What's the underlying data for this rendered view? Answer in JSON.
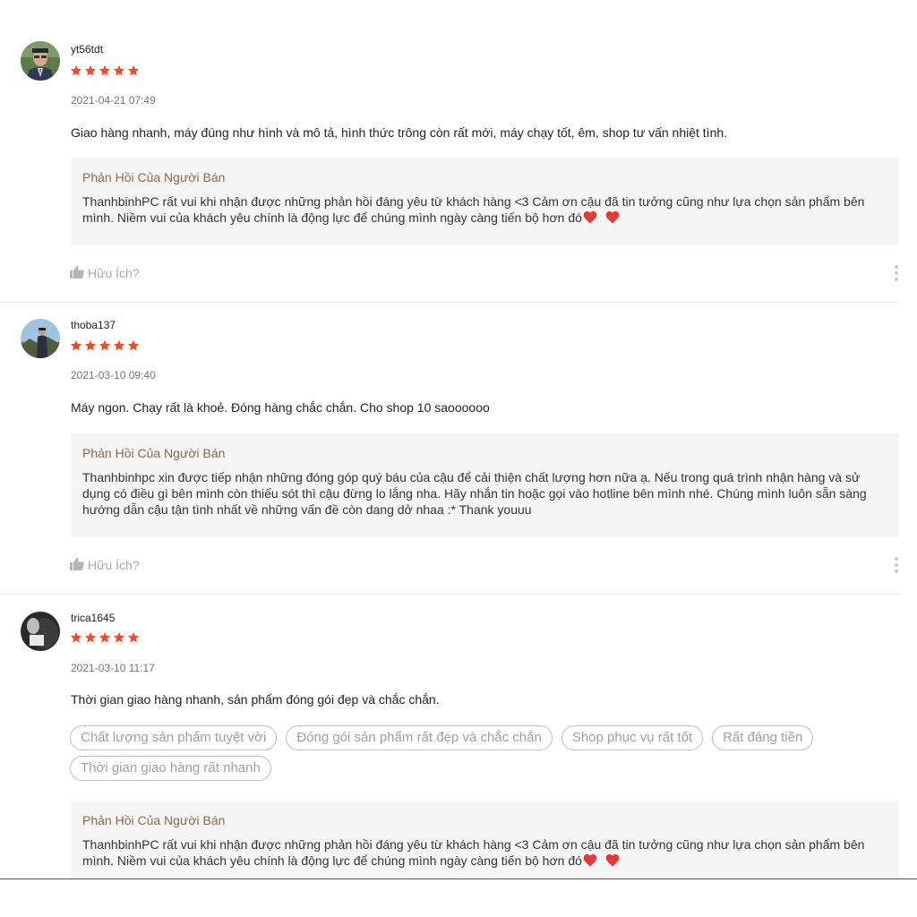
{
  "colors": {
    "star": "#ee4d2d",
    "reply_title": "#8b6a46",
    "reply_bg": "#f5f5f5",
    "heart": "#e53935"
  },
  "reviews": [
    {
      "username": "yt56tdt",
      "rating": 5,
      "date": "2021-04-21 07:49",
      "comment": "Giao hàng nhanh, máy đúng như hình và mô tả, hình thức trông còn rất mới, máy chạy tốt, êm, shop tư vấn nhiệt tình.",
      "reply_title": "Phản Hồi Của Người Bán",
      "reply_text": "ThanhbinhPC rất vui khi nhận được những phản hồi đáng yêu từ khách hàng <3 Cảm ơn cậu đã tin tưởng cũng như lựa chọn sản phẩm bên mình. Niềm vui của khách yêu chính là động lực để chúng mình ngày càng tiến bộ hơn đó",
      "helpful_label": "Hữu Ích?"
    },
    {
      "username": "thoba137",
      "rating": 5,
      "date": "2021-03-10 09:40",
      "comment": "Máy ngon. Chạy rất là khoẻ. Đóng hàng chắc chắn. Cho shop 10 saoooooo",
      "reply_title": "Phản Hồi Của Người Bán",
      "reply_text": "Thanhbinhpc xin được tiếp nhận những đóng góp quý báu của cậu để cải thiện chất lượng hơn nữa ạ. Nếu trong quá trình nhận hàng và sử dụng có điều gì bên mình còn thiếu sót thì cậu đừng lo lắng nha. Hãy nhắn tin hoặc gọi vào hotline bên mình nhé. Chúng mình luôn sẵn sàng hướng dẫn cậu tận tình nhất về những vấn đề còn dang dở nhaa :* Thank youuu",
      "helpful_label": "Hữu Ích?"
    },
    {
      "username": "trica1645",
      "rating": 5,
      "date": "2021-03-10 11:17",
      "comment": "Thời gian giao hàng nhanh, sản phẩm đóng gói đẹp và chắc chắn.",
      "tags": [
        "Chất lượng sản phẩm tuyệt vời",
        "Đóng gói sản phẩm rất đẹp và chắc chắn",
        "Shop phục vụ rất tốt",
        "Rất đáng tiền",
        "Thời gian giao hàng rất nhanh"
      ],
      "reply_title": "Phản Hồi Của Người Bán",
      "reply_text": "ThanhbinhPC rất vui khi nhận được những phản hồi đáng yêu từ khách hàng <3 Cảm ơn cậu đã tin tưởng cũng như lựa chọn sản phẩm bên mình. Niềm vui của khách yêu chính là động lực để chúng mình ngày càng tiến bộ hơn đó"
    }
  ]
}
